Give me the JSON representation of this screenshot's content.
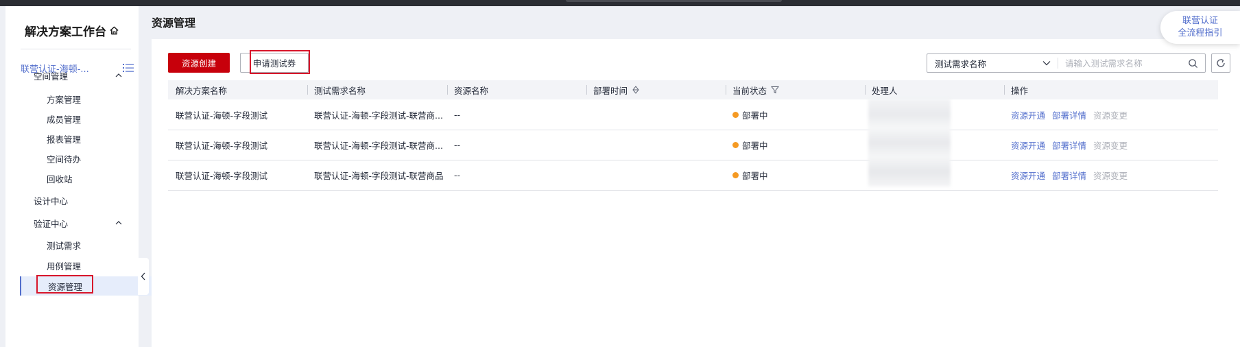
{
  "sidebar": {
    "title": "解决方案工作台",
    "project": "联营认证-海顿-...",
    "items": [
      {
        "label": "空间管理"
      },
      {
        "label": "方案管理"
      },
      {
        "label": "成员管理"
      },
      {
        "label": "报表管理"
      },
      {
        "label": "空间待办"
      },
      {
        "label": "回收站"
      },
      {
        "label": "设计中心"
      },
      {
        "label": "验证中心"
      },
      {
        "label": "测试需求"
      },
      {
        "label": "用例管理"
      },
      {
        "label": "资源管理"
      }
    ]
  },
  "page": {
    "title": "资源管理"
  },
  "toolbar": {
    "create_label": "资源创建",
    "apply_label": "申请测试券"
  },
  "filter": {
    "select_value": "测试需求名称",
    "search_placeholder": "请输入测试需求名称"
  },
  "table": {
    "columns": [
      "解决方案名称",
      "测试需求名称",
      "资源名称",
      "部署时间",
      "当前状态",
      "处理人",
      "操作"
    ],
    "rows": [
      {
        "solution": "联营认证-海顿-字段测试",
        "requirement": "联营认证-海顿-字段测试-联营商...",
        "resource": "--",
        "deploy_time": "",
        "status": "部署中",
        "handler": "",
        "actions": [
          "资源开通",
          "部署详情",
          "资源变更"
        ]
      },
      {
        "solution": "联营认证-海顿-字段测试",
        "requirement": "联营认证-海顿-字段测试-联营商...",
        "resource": "--",
        "deploy_time": "",
        "status": "部署中",
        "handler": "",
        "actions": [
          "资源开通",
          "部署详情",
          "资源变更"
        ]
      },
      {
        "solution": "联营认证-海顿-字段测试",
        "requirement": "联营认证-海顿-字段测试-联营商品",
        "resource": "--",
        "deploy_time": "",
        "status": "部署中",
        "handler": "",
        "actions": [
          "资源开通",
          "部署详情",
          "资源变更"
        ]
      }
    ]
  },
  "help": {
    "line1": "联营认证",
    "line2": "全流程指引"
  },
  "colors": {
    "brand_red": "#c7000b",
    "link_blue": "#526ecc",
    "status_orange": "#f59a23",
    "annotation_red": "#d8152a"
  }
}
